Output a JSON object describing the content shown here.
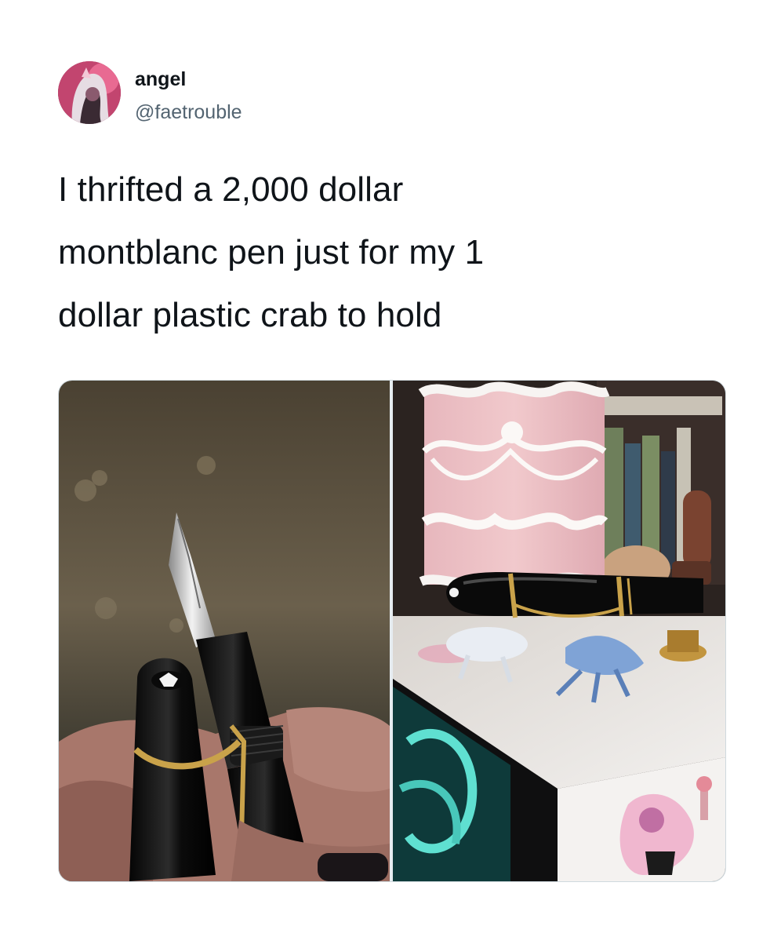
{
  "author": {
    "name": "angel",
    "handle": "@faetrouble"
  },
  "tweet": {
    "text": "I thrifted a 2,000 dollar\nmontblanc pen just for my 1\ndollar plastic crab to hold"
  },
  "media": [
    {
      "icon": "fountain-pen-photo"
    },
    {
      "icon": "crab-holding-pen-photo"
    }
  ],
  "colors": {
    "text_primary": "#0f1419",
    "text_secondary": "#536471",
    "border": "#cfd9de"
  }
}
